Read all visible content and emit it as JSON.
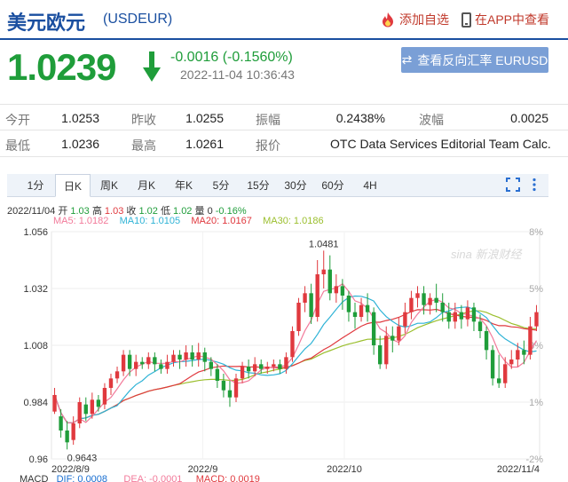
{
  "header": {
    "title": "美元欧元",
    "code": "(USDEUR)",
    "add_watch": "添加自选",
    "app_view": "在APP中查看"
  },
  "quote": {
    "price": "1.0239",
    "change": "-0.0016 (-0.1560%)",
    "timestamp": "2022-11-04 10:36:43",
    "reverse_button": "查看反向汇率 EURUSD",
    "color_down": "#1f9d3a",
    "color_up": "#e0393e"
  },
  "stats": {
    "open_label": "今开",
    "open": "1.0253",
    "prev_close_label": "昨收",
    "prev_close": "1.0255",
    "amplitude_label": "振幅",
    "amplitude": "0.2438%",
    "wave_label": "波幅",
    "wave": "0.0025",
    "low_label": "最低",
    "low": "1.0236",
    "high_label": "最高",
    "high": "1.0261",
    "quote_label": "报价",
    "quote_source": "OTC Data Services Editorial Team Calc..."
  },
  "tabs": [
    "1分",
    "日K",
    "周K",
    "月K",
    "年K",
    "5分",
    "15分",
    "30分",
    "60分",
    "4H"
  ],
  "active_tab": "日K",
  "candle_info": {
    "date": "2022/11/04",
    "open_label": "开",
    "open": "1.03",
    "high_label": "高",
    "high": "1.03",
    "close_label": "收",
    "close": "1.02",
    "low_label": "低",
    "low": "1.02",
    "volume_label": "量",
    "volume": "0",
    "change": "-0.16%"
  },
  "ma": {
    "ma5": "MA5: 1.0182",
    "ma10": "MA10: 1.0105",
    "ma20": "MA20: 1.0167",
    "ma30": "MA30: 1.0186"
  },
  "macd": {
    "label": "MACD",
    "dif": "DIF: 0.0008",
    "dea": "DEA: -0.0001",
    "macd": "MACD: 0.0019"
  },
  "watermark": "sina 新浪财经",
  "chart_data": {
    "type": "candlestick",
    "y_ticks": [
      "1.056",
      "1.032",
      "1.008",
      "0.984",
      "0.96"
    ],
    "pct_ticks": [
      "8%",
      "5%",
      "3%",
      "1%",
      "-2%"
    ],
    "x_ticks": [
      "2022/8/9",
      "2022/9",
      "2022/10",
      "2022/11/4"
    ],
    "ylim": [
      0.96,
      1.056
    ],
    "max_label": "1.0481",
    "min_label": "0.9643",
    "ma_colors": {
      "ma5": "#f27a9a",
      "ma10": "#2fb3d6",
      "ma20": "#e0393e",
      "ma30": "#9bbf2e"
    },
    "candles": [
      [
        0.98,
        0.987,
        0.979,
        0.99
      ],
      [
        0.978,
        0.972,
        0.969,
        0.981
      ],
      [
        0.972,
        0.967,
        0.964,
        0.976
      ],
      [
        0.968,
        0.975,
        0.966,
        0.978
      ],
      [
        0.975,
        0.984,
        0.973,
        0.986
      ],
      [
        0.983,
        0.979,
        0.976,
        0.986
      ],
      [
        0.979,
        0.985,
        0.977,
        0.988
      ],
      [
        0.985,
        0.982,
        0.98,
        0.987
      ],
      [
        0.983,
        0.99,
        0.981,
        0.992
      ],
      [
        0.99,
        0.994,
        0.987,
        0.996
      ],
      [
        0.994,
        0.997,
        0.992,
        0.999
      ],
      [
        0.997,
        1.004,
        0.995,
        1.006
      ],
      [
        1.004,
        0.998,
        0.995,
        1.006
      ],
      [
        0.998,
        1.001,
        0.995,
        1.004
      ],
      [
        1.001,
        1.0,
        0.998,
        1.003
      ],
      [
        1.0,
        1.003,
        0.998,
        1.005
      ],
      [
        1.003,
        1.0,
        0.997,
        1.005
      ],
      [
        1.0,
        0.998,
        0.996,
        1.002
      ],
      [
        0.998,
        1.001,
        0.996,
        1.004
      ],
      [
        1.001,
        1.004,
        0.999,
        1.006
      ],
      [
        1.004,
        1.002,
        0.998,
        1.006
      ],
      [
        1.002,
        1.005,
        0.999,
        1.008
      ],
      [
        1.005,
        1.002,
        0.999,
        1.008
      ],
      [
        1.002,
        1.005,
        0.999,
        1.009
      ],
      [
        1.005,
        1.001,
        0.997,
        1.007
      ],
      [
        1.001,
        0.998,
        0.995,
        1.003
      ],
      [
        0.998,
        0.993,
        0.99,
        1.0
      ],
      [
        0.993,
        0.989,
        0.986,
        0.996
      ],
      [
        0.989,
        0.986,
        0.982,
        0.993
      ],
      [
        0.986,
        0.994,
        0.984,
        0.996
      ],
      [
        0.994,
        0.999,
        0.992,
        1.001
      ],
      [
        0.999,
        0.997,
        0.994,
        1.002
      ],
      [
        0.997,
        1.0,
        0.995,
        1.003
      ],
      [
        1.0,
        0.998,
        0.996,
        1.002
      ],
      [
        0.998,
        0.999,
        0.996,
        1.001
      ],
      [
        0.999,
        1.0,
        0.997,
        1.002
      ],
      [
        1.0,
        0.998,
        0.996,
        1.002
      ],
      [
        0.998,
        1.003,
        0.996,
        1.005
      ],
      [
        1.003,
        1.014,
        1.001,
        1.016
      ],
      [
        1.014,
        1.026,
        1.012,
        1.028
      ],
      [
        1.026,
        1.03,
        1.022,
        1.033
      ],
      [
        1.03,
        1.02,
        1.017,
        1.034
      ],
      [
        1.02,
        1.038,
        1.018,
        1.044
      ],
      [
        1.038,
        1.04,
        1.032,
        1.048
      ],
      [
        1.04,
        1.03,
        1.027,
        1.046
      ],
      [
        1.03,
        1.033,
        1.026,
        1.038
      ],
      [
        1.033,
        1.029,
        1.023,
        1.036
      ],
      [
        1.029,
        1.022,
        1.018,
        1.031
      ],
      [
        1.022,
        1.02,
        1.015,
        1.026
      ],
      [
        1.02,
        1.025,
        1.018,
        1.028
      ],
      [
        1.025,
        1.022,
        1.018,
        1.03
      ],
      [
        1.022,
        1.008,
        1.004,
        1.024
      ],
      [
        1.008,
        1.0,
        0.998,
        1.012
      ],
      [
        1.0,
        1.012,
        0.998,
        1.016
      ],
      [
        1.012,
        1.01,
        1.005,
        1.016
      ],
      [
        1.01,
        1.016,
        1.008,
        1.02
      ],
      [
        1.016,
        1.022,
        1.013,
        1.026
      ],
      [
        1.022,
        1.028,
        1.019,
        1.031
      ],
      [
        1.028,
        1.03,
        1.024,
        1.033
      ],
      [
        1.03,
        1.025,
        1.021,
        1.033
      ],
      [
        1.025,
        1.028,
        1.021,
        1.03
      ],
      [
        1.028,
        1.026,
        1.022,
        1.034
      ],
      [
        1.026,
        1.022,
        1.018,
        1.03
      ],
      [
        1.022,
        1.018,
        1.015,
        1.026
      ],
      [
        1.018,
        1.022,
        1.015,
        1.026
      ],
      [
        1.022,
        1.019,
        1.015,
        1.025
      ],
      [
        1.019,
        1.024,
        1.016,
        1.027
      ],
      [
        1.024,
        1.018,
        1.014,
        1.026
      ],
      [
        1.018,
        1.014,
        1.011,
        1.021
      ],
      [
        1.014,
        1.006,
        1.002,
        1.016
      ],
      [
        1.006,
        0.994,
        0.991,
        1.008
      ],
      [
        0.994,
        0.992,
        0.99,
        1.004
      ],
      [
        0.992,
        1.0,
        0.99,
        1.003
      ],
      [
        1.0,
        1.002,
        0.998,
        1.006
      ],
      [
        1.002,
        1.006,
        0.999,
        1.009
      ],
      [
        1.006,
        1.004,
        1.0,
        1.01
      ],
      [
        1.004,
        1.016,
        1.002,
        1.02
      ],
      [
        1.016,
        1.022,
        1.014,
        1.025
      ]
    ]
  }
}
